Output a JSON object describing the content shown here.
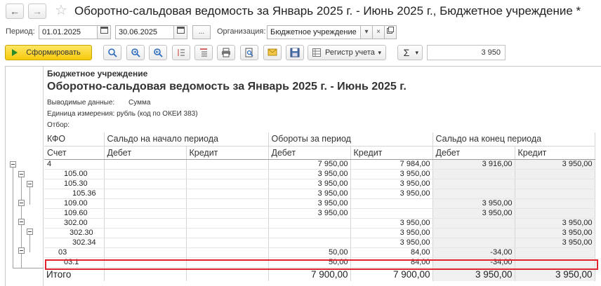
{
  "window": {
    "title": "Оборотно-сальдовая ведомость за Январь 2025 г. - Июнь 2025 г., Бюджетное учреждение *"
  },
  "params": {
    "period_label": "Период:",
    "date_from": "01.01.2025",
    "date_to": "30.06.2025",
    "ellipsis": "...",
    "org_label": "Организация:",
    "org_value": "Бюджетное учреждение"
  },
  "toolbar": {
    "generate_label": "Сформировать",
    "register_label": "Регистр учета",
    "sigma": "Σ",
    "sum_value": "3 950"
  },
  "report": {
    "org": "Бюджетное учреждение",
    "title": "Оборотно-сальдовая ведомость за Январь 2025 г. - Июнь 2025 г.",
    "shown_label": "Выводимые данные:",
    "shown_value": "Сумма",
    "unit_label": "Единица измерения:",
    "unit_value": "рубль (код по ОКЕИ 383)",
    "filter_label": "Отбор:",
    "header": {
      "kfo": "КФО",
      "account": "Счет",
      "opening": "Сальдо на начало периода",
      "turnover": "Обороты за период",
      "closing": "Сальдо на конец периода",
      "debit": "Дебет",
      "credit": "Кредит"
    },
    "rows": [
      {
        "account": "4",
        "cells": [
          "",
          "",
          "7 950,00",
          "7 984,00",
          "3 916,00",
          "3 950,00"
        ]
      },
      {
        "account": "105.00",
        "cells": [
          "",
          "",
          "3 950,00",
          "3 950,00",
          "",
          ""
        ]
      },
      {
        "account": "105.30",
        "cells": [
          "",
          "",
          "3 950,00",
          "3 950,00",
          "",
          ""
        ]
      },
      {
        "account": "105.36",
        "cells": [
          "",
          "",
          "3 950,00",
          "3 950,00",
          "",
          ""
        ]
      },
      {
        "account": "109.00",
        "cells": [
          "",
          "",
          "3 950,00",
          "",
          "3 950,00",
          ""
        ]
      },
      {
        "account": "109.60",
        "cells": [
          "",
          "",
          "3 950,00",
          "",
          "3 950,00",
          ""
        ]
      },
      {
        "account": "302.00",
        "cells": [
          "",
          "",
          "",
          "3 950,00",
          "",
          "3 950,00"
        ]
      },
      {
        "account": "302.30",
        "cells": [
          "",
          "",
          "",
          "3 950,00",
          "",
          "3 950,00"
        ]
      },
      {
        "account": "302.34",
        "cells": [
          "",
          "",
          "",
          "3 950,00",
          "",
          "3 950,00"
        ]
      },
      {
        "account": "03",
        "cells": [
          "",
          "",
          "50,00",
          "84,00",
          "-34,00",
          ""
        ]
      },
      {
        "account": "03.1",
        "cells": [
          "",
          "",
          "50,00",
          "84,00",
          "-34,00",
          ""
        ]
      }
    ],
    "total": {
      "label": "Итого",
      "cells": [
        "",
        "",
        "7 900,00",
        "7 900,00",
        "3 950,00",
        "3 950,00"
      ]
    }
  },
  "colors": {
    "highlight": "#e0232f",
    "negative": "#e01010",
    "generate_button": "#f7c90b"
  }
}
